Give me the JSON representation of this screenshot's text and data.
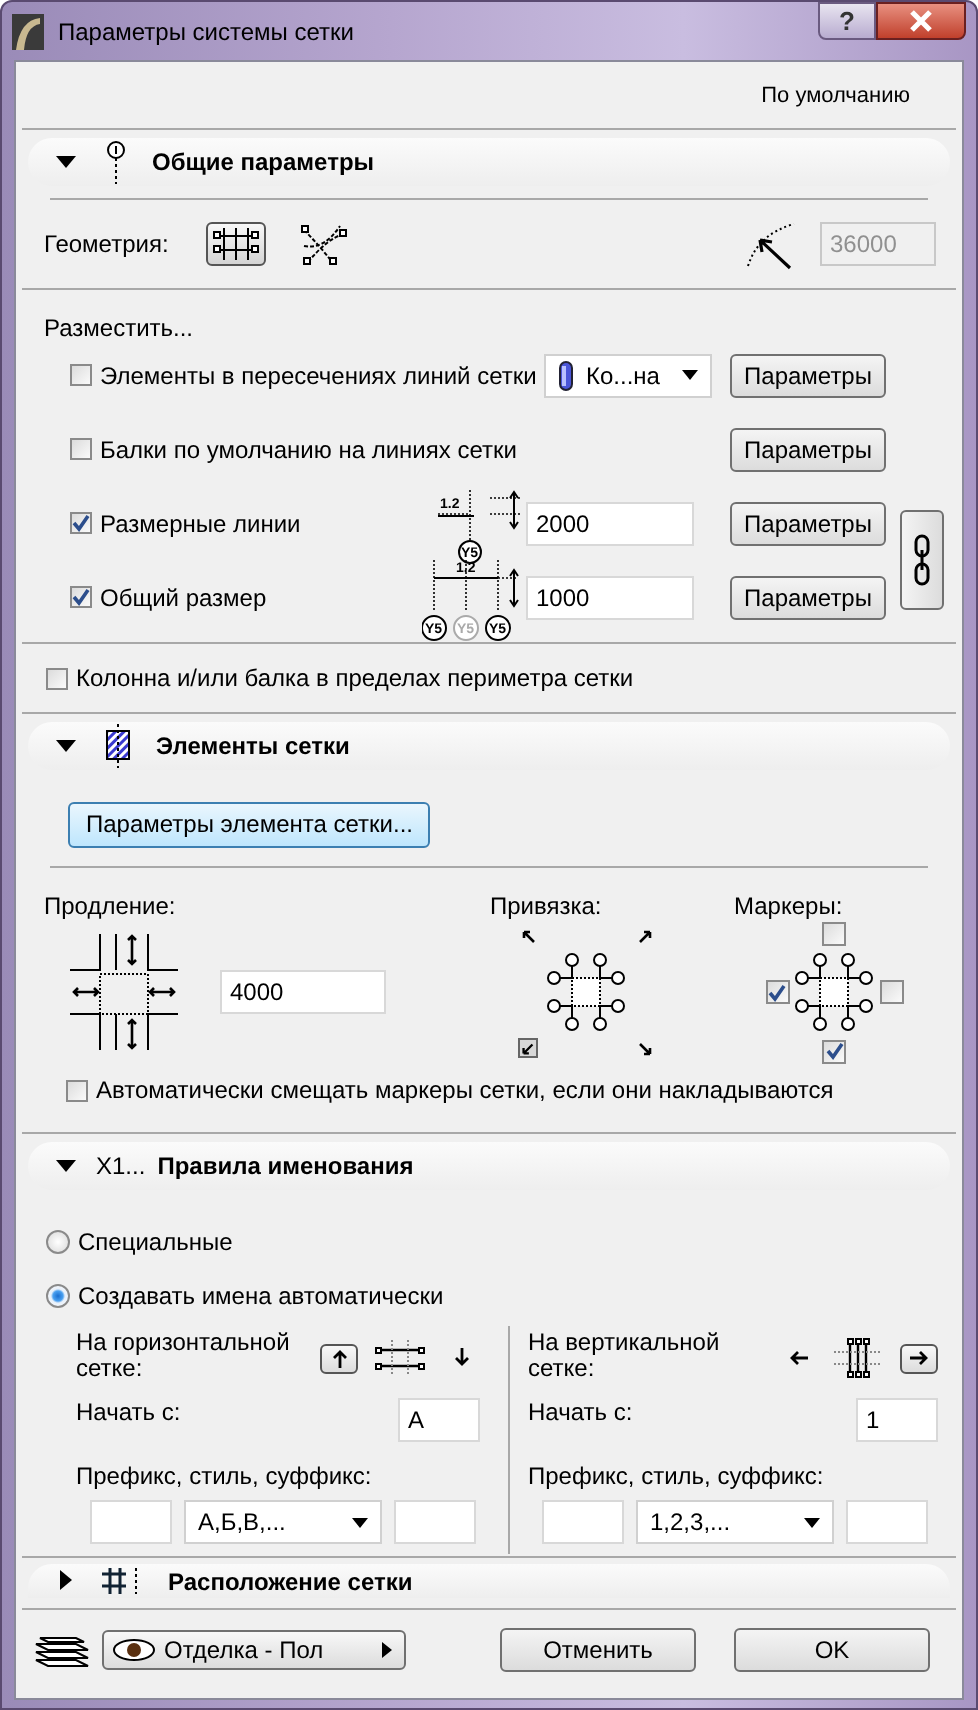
{
  "window": {
    "title": "Параметры системы сетки",
    "help": "?"
  },
  "defaults_label": "По умолчанию",
  "sections": [
    {
      "kind": "general",
      "title": "Общие параметры",
      "expanded": true,
      "geometry": {
        "label": "Геометрия:",
        "options": [
          {
            "kind": "orthogonal",
            "selected": true
          },
          {
            "kind": "polar",
            "selected": false
          }
        ],
        "angle_value": "36000",
        "angle_disabled": true
      },
      "place_label": "Разместить...",
      "place_items": [
        {
          "kind": "dropdown",
          "label": "Элементы в пересечениях линий сетки",
          "checked": false,
          "dropdown": "Ко...на",
          "button": "Параметры"
        },
        {
          "kind": "plain",
          "label": "Балки по умолчанию на линиях сетки",
          "checked": false,
          "button": "Параметры"
        },
        {
          "kind": "dimension",
          "label": "Размерные линии",
          "checked": true,
          "dim_label": "1.2",
          "markers": [
            "Y5"
          ],
          "value": "2000",
          "button": "Параметры"
        },
        {
          "kind": "overall",
          "label": "Общий размер",
          "checked": true,
          "dim_label": "1.2",
          "markers": [
            "Y5",
            "Y5",
            "Y5"
          ],
          "value": "1000",
          "button": "Параметры"
        }
      ],
      "linked": true,
      "perimeter": {
        "label": "Колонна и/или балка в пределах периметра сетки",
        "checked": false
      }
    },
    {
      "kind": "elements",
      "title": "Элементы сетки",
      "expanded": true,
      "settings_button": "Параметры элемента сетки...",
      "extension": {
        "label": "Продление:",
        "value": "4000"
      },
      "anchor": {
        "label": "Привязка:",
        "corners": [
          {
            "kind": "top-left",
            "selected": false
          },
          {
            "kind": "top-right",
            "selected": false
          },
          {
            "kind": "bottom-left",
            "selected": true
          },
          {
            "kind": "bottom-right",
            "selected": false
          }
        ]
      },
      "markers": {
        "label": "Маркеры:",
        "sides": [
          {
            "kind": "top",
            "checked": false
          },
          {
            "kind": "left",
            "checked": true
          },
          {
            "kind": "right",
            "checked": false
          },
          {
            "kind": "bottom",
            "checked": true
          }
        ]
      },
      "auto_offset": {
        "label": "Автоматически смещать маркеры сетки, если они накладываются",
        "checked": false
      }
    },
    {
      "kind": "naming",
      "title": "Правила именования",
      "icon_text": "X1...",
      "expanded": true,
      "options": [
        {
          "label": "Специальные",
          "selected": false
        },
        {
          "label": "Создавать имена автоматически",
          "selected": true
        }
      ],
      "columns": [
        {
          "kind": "horizontal",
          "label": "На горизонтальной сетке:",
          "directions": [
            {
              "kind": "up",
              "selected": true
            },
            {
              "kind": "down",
              "selected": false
            }
          ],
          "start_label": "Начать с:",
          "start_value": "А",
          "style_label": "Префикс, стиль, суффикс:",
          "style": "А,Б,В,..."
        },
        {
          "kind": "vertical",
          "label": "На вертикальной сетке:",
          "directions": [
            {
              "kind": "left",
              "selected": false
            },
            {
              "kind": "right",
              "selected": true
            }
          ],
          "start_label": "Начать с:",
          "start_value": "1",
          "style_label": "Префикс, стиль, суффикс:",
          "style": "1,2,3,..."
        }
      ]
    },
    {
      "kind": "layout",
      "title": "Расположение сетки",
      "expanded": false
    }
  ],
  "footer": {
    "layer": "Отделка - Пол",
    "cancel": "Отменить",
    "ok": "OK"
  }
}
